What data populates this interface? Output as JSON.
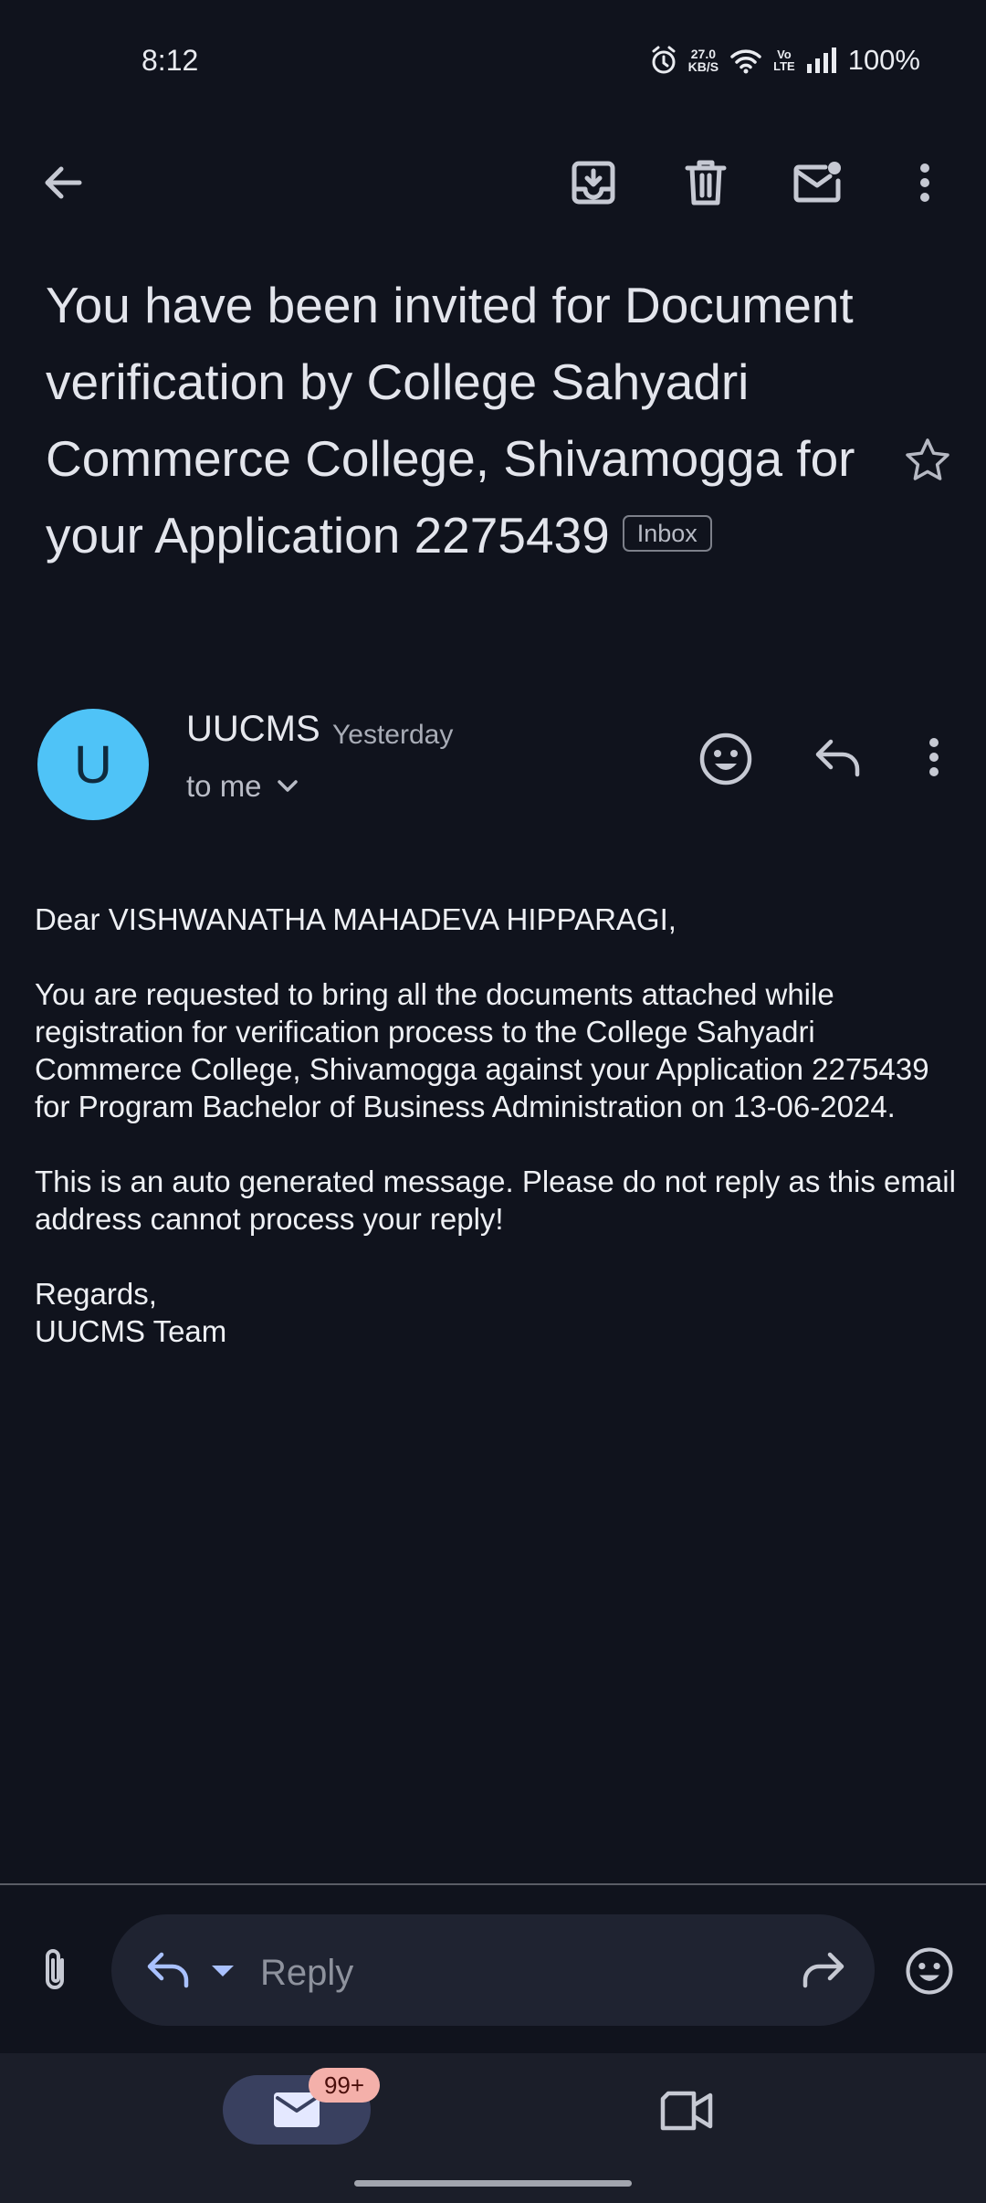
{
  "status_bar": {
    "time": "8:12",
    "net_speed_value": "27.0",
    "net_speed_unit": "KB/S",
    "volte_line1": "Vo",
    "volte_line2": "LTE",
    "battery": "100%"
  },
  "toolbar": {
    "icons": [
      "back-arrow-icon",
      "archive-icon",
      "delete-icon",
      "mark-unread-icon",
      "more-vert-icon"
    ]
  },
  "email": {
    "subject": "You have been invited for Document verification by College Sahyadri Commerce College, Shivamogga for your Application 2275439",
    "label_chip": "Inbox",
    "sender_initial": "U",
    "sender_name": "UUCMS",
    "time": "Yesterday",
    "recipient": "to me",
    "body": {
      "greeting": "Dear VISHWANATHA MAHADEVA HIPPARAGI,",
      "paragraph1": "You are requested to bring all the documents attached while registration for verification process to the College Sahyadri Commerce College, Shivamogga against your Application 2275439 for Program Bachelor of Business Administration on 13-06-2024.",
      "paragraph2": "This is an auto generated message. Please do not reply as this email address cannot process your reply!",
      "signoff": "Regards,",
      "signature": "UUCMS Team"
    }
  },
  "reply_bar": {
    "placeholder": "Reply"
  },
  "bottom_nav": {
    "mail_badge": "99+"
  },
  "colors": {
    "background": "#10131d",
    "avatar": "#4fc3f7",
    "badge": "#f4b0aa",
    "nav_pill": "#39405f"
  }
}
